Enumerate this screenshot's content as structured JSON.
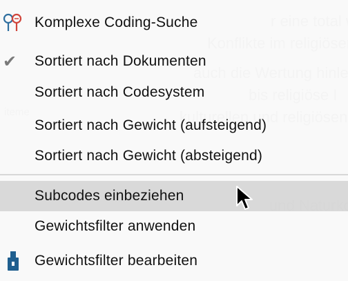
{
  "background": {
    "lines": [
      "r eine total welt g",
      "Konflikte im religiösen und kulturell",
      "auch die Wertung hinlegen, weil",
      "bis religiöse I",
      "kulturellen und religiösen Konflikten",
      "iteme",
      "und Naturko"
    ]
  },
  "menu": {
    "items": [
      {
        "label": "Komplexe Coding-Suche",
        "icon": "search-filter-icon"
      },
      {
        "label": "Sortiert nach Dokumenten",
        "checked": true
      },
      {
        "label": "Sortiert nach Codesystem"
      },
      {
        "label": "Sortiert nach Gewicht (aufsteigend)"
      },
      {
        "label": "Sortiert nach Gewicht (absteigend)"
      },
      {
        "label": "Subcodes einbeziehen",
        "highlighted": true
      },
      {
        "label": "Gewichtsfilter anwenden"
      },
      {
        "label": "Gewichtsfilter bearbeiten",
        "icon": "weight-icon"
      }
    ]
  },
  "colors": {
    "highlight": "#cdcdcd",
    "icon_blue": "#2f6f9f",
    "icon_red": "#d0443a",
    "weight_icon": "#1f5f8f"
  }
}
